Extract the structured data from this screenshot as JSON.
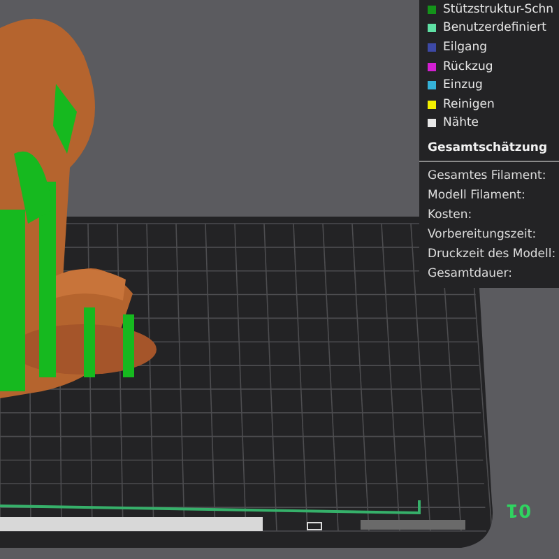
{
  "legend": {
    "items": [
      {
        "label": "Stützstruktur-Schn",
        "color": "#14931a"
      },
      {
        "label": "Benutzerdefiniert",
        "color": "#5fe0a4"
      },
      {
        "label": "Eilgang",
        "color": "#3d49a6"
      },
      {
        "label": "Rückzug",
        "color": "#d21fd2"
      },
      {
        "label": "Einzug",
        "color": "#35b2d8"
      },
      {
        "label": "Reinigen",
        "color": "#f2f000"
      },
      {
        "label": "Nähte",
        "color": "#e8e8e8"
      }
    ]
  },
  "summary": {
    "title": "Gesamtschätzung",
    "rows": [
      "Gesamtes Filament:",
      "Modell Filament:",
      "Kosten:",
      "Vorbereitungszeit:",
      "Druckzeit des Modell:",
      "Gesamtdauer:"
    ]
  },
  "bed": {
    "label": "01"
  }
}
